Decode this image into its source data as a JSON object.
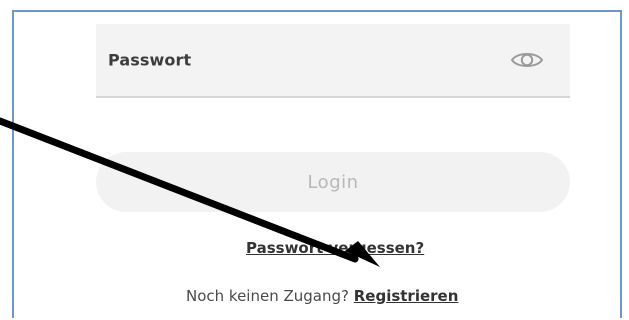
{
  "form": {
    "password_label": "Passwort",
    "login_label": "Login",
    "forgot_password_link": "Passwort vergessen?",
    "no_account_text": "Noch keinen Zugang? ",
    "register_link": "Registrieren"
  },
  "icons": {
    "password_toggle": "eye-icon",
    "annotation": "arrow-annotation"
  },
  "colors": {
    "frame_border": "#6d97c6",
    "field_background": "#f3f3f3",
    "button_background": "#f2f2f2",
    "button_text": "#b8b8b8",
    "link_text": "#333333",
    "arrow": "#000000"
  }
}
